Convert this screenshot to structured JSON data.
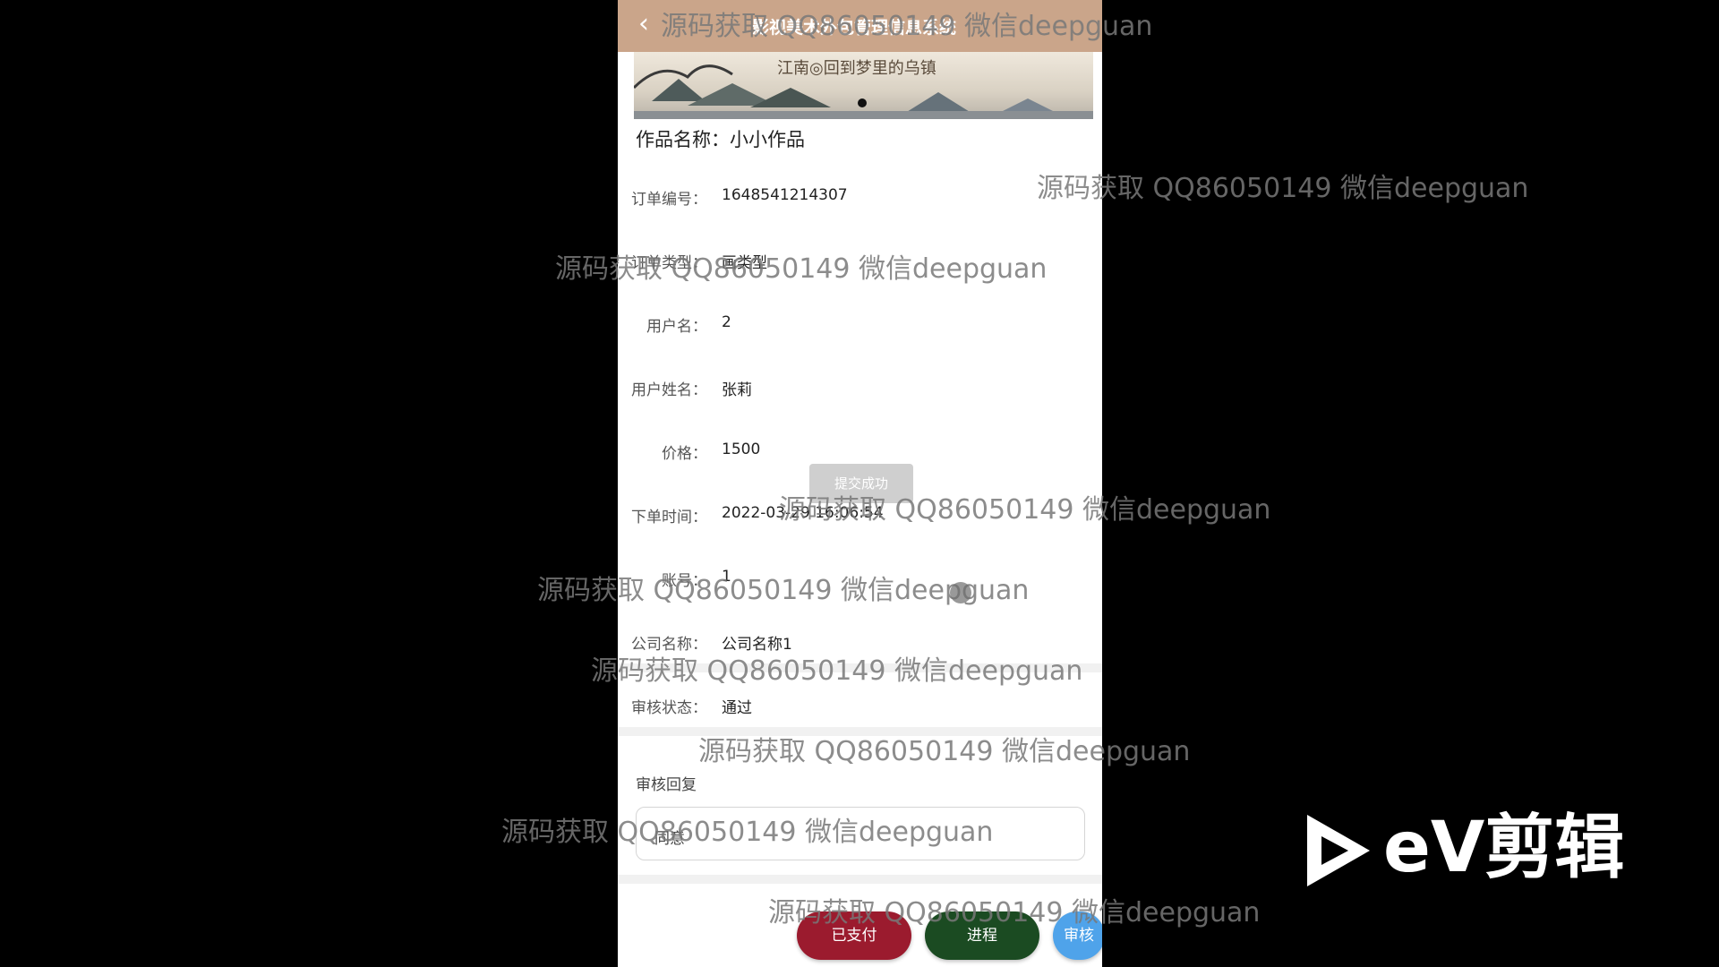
{
  "header": {
    "back_icon": "chevron-left-icon",
    "title": "影视美术外包管理信息系统"
  },
  "banner": {
    "caption": "江南◎回到梦里的乌镇"
  },
  "work": {
    "label": "作品名称：",
    "value": "小小作品"
  },
  "fields": [
    {
      "label": "订单编号：",
      "value": "1648541214307"
    },
    {
      "label": "订单类型：",
      "value": "画类型"
    },
    {
      "label": "用户名：",
      "value": "2"
    },
    {
      "label": "用户姓名：",
      "value": "张莉"
    },
    {
      "label": "价格：",
      "value": "1500"
    },
    {
      "label": "下单时间：",
      "value": "2022-03-29 16:06:54"
    },
    {
      "label": "账号：",
      "value": "1"
    },
    {
      "label": "公司名称：",
      "value": "公司名称1"
    },
    {
      "label": "审核状态：",
      "value": "通过"
    }
  ],
  "toast": "提交成功",
  "reply": {
    "label": "审核回复",
    "value": "同意"
  },
  "buttons": {
    "paid": "已支付",
    "progress": "进程",
    "audit": "审核"
  },
  "watermark": "源码获取 QQ86050149 微信deepguan",
  "ev_logo": {
    "text": "eV剪辑"
  },
  "colors": {
    "header": "#caa58a",
    "paid": "#9b1b2e",
    "progress": "#1b4b22",
    "audit": "#4fa3ea"
  }
}
